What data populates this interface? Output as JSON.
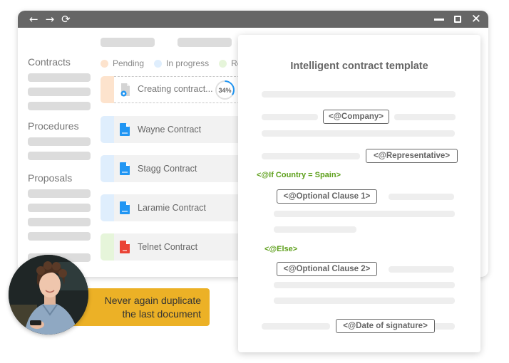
{
  "window": {
    "nav": {
      "back_icon": "←",
      "forward_icon": "→",
      "reload_icon": "⟳"
    },
    "controls": {
      "minimize": "minimize",
      "maximize": "maximize",
      "close_icon": "✕"
    }
  },
  "sidebar": {
    "sections": [
      {
        "heading": "Contracts"
      },
      {
        "heading": "Procedures"
      },
      {
        "heading": "Proposals"
      }
    ]
  },
  "legend": [
    {
      "label": "Pending",
      "color": "#fde3cd"
    },
    {
      "label": "In progress",
      "color": "#dfeefd"
    },
    {
      "label": "Re",
      "color": "#e6f5da"
    }
  ],
  "contracts": {
    "creating": {
      "label": "Creating contract...",
      "progress_percent": 34,
      "progress_text": "34%",
      "status": "Pending"
    },
    "items": [
      {
        "label": "Wayne Contract",
        "type": "DOCX",
        "status": "In progress"
      },
      {
        "label": "Stagg Contract",
        "type": "DOCX",
        "status": "In progress"
      },
      {
        "label": "Laramie Contract",
        "type": "DOCX",
        "status": "In progress"
      },
      {
        "label": "Telnet Contract",
        "type": "PDF",
        "status": "Ready"
      }
    ]
  },
  "template": {
    "title": "Intelligent contract template",
    "tags": {
      "company": "<@Company>",
      "representative": "<@Representative>",
      "if_country": "<@If Country = Spain>",
      "clause1": "<@Optional Clause 1>",
      "else": "<@Else>",
      "clause2": "<@Optional Clause 2>",
      "date": "<@Date of signature>"
    }
  },
  "callout": {
    "line1": "Never again duplicate",
    "line2": "the last document"
  },
  "colors": {
    "titlebar": "#666666",
    "accent_blue": "#2196f3",
    "pdf_red": "#ea4335",
    "condition_green": "#5ea01c",
    "callout_yellow": "#ecb126"
  }
}
